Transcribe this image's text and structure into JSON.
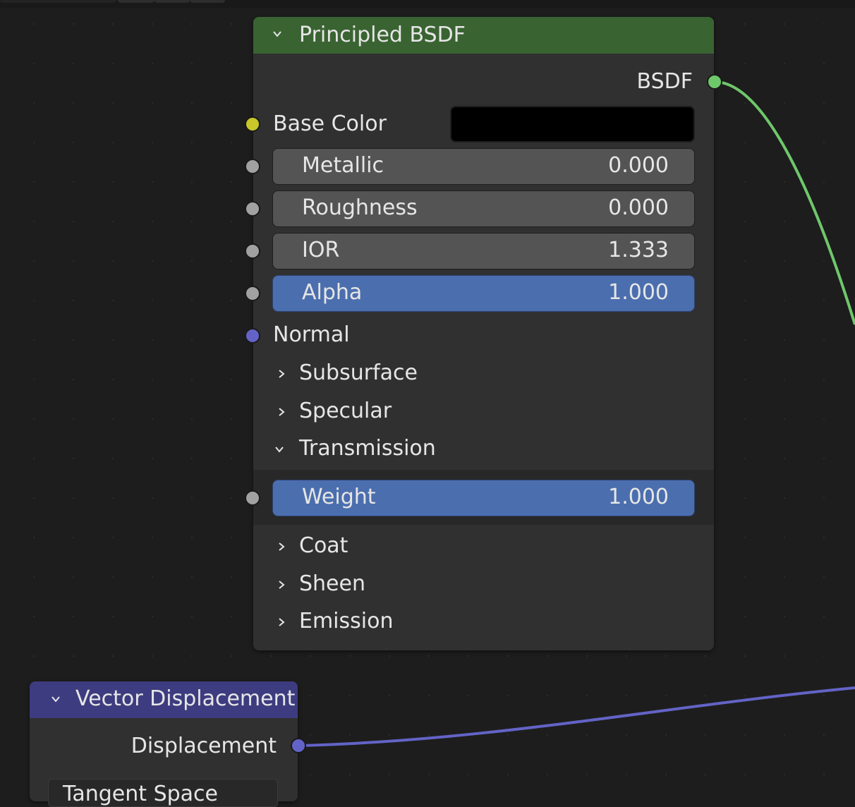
{
  "principled": {
    "title": "Principled BSDF",
    "header_color": "#3a6332",
    "output_label": "BSDF",
    "base_color_label": "Base Color",
    "base_color_value": "#000000",
    "fields": [
      {
        "label": "Metallic",
        "value": "0.000"
      },
      {
        "label": "Roughness",
        "value": "0.000"
      },
      {
        "label": "IOR",
        "value": "1.333"
      },
      {
        "label": "Alpha",
        "value": "1.000"
      }
    ],
    "normal_label": "Normal",
    "panels": {
      "subsurface": "Subsurface",
      "specular": "Specular",
      "transmission": "Transmission",
      "coat": "Coat",
      "sheen": "Sheen",
      "emission": "Emission"
    },
    "transmission_weight": {
      "label": "Weight",
      "value": "1.000"
    }
  },
  "vector_displacement": {
    "title": "Vector Displacement",
    "header_color": "#3d3c80",
    "output_label": "Displacement",
    "space_value": "Tangent Space"
  },
  "colors": {
    "shader_socket": "#6fc76b",
    "color_socket": "#c7c729",
    "float_socket": "#a1a1a1",
    "vector_socket": "#6363c7",
    "active_field": "#4b6eae"
  },
  "icons": {
    "expanded": "chevron-down-icon",
    "collapsed": "chevron-right-icon"
  }
}
